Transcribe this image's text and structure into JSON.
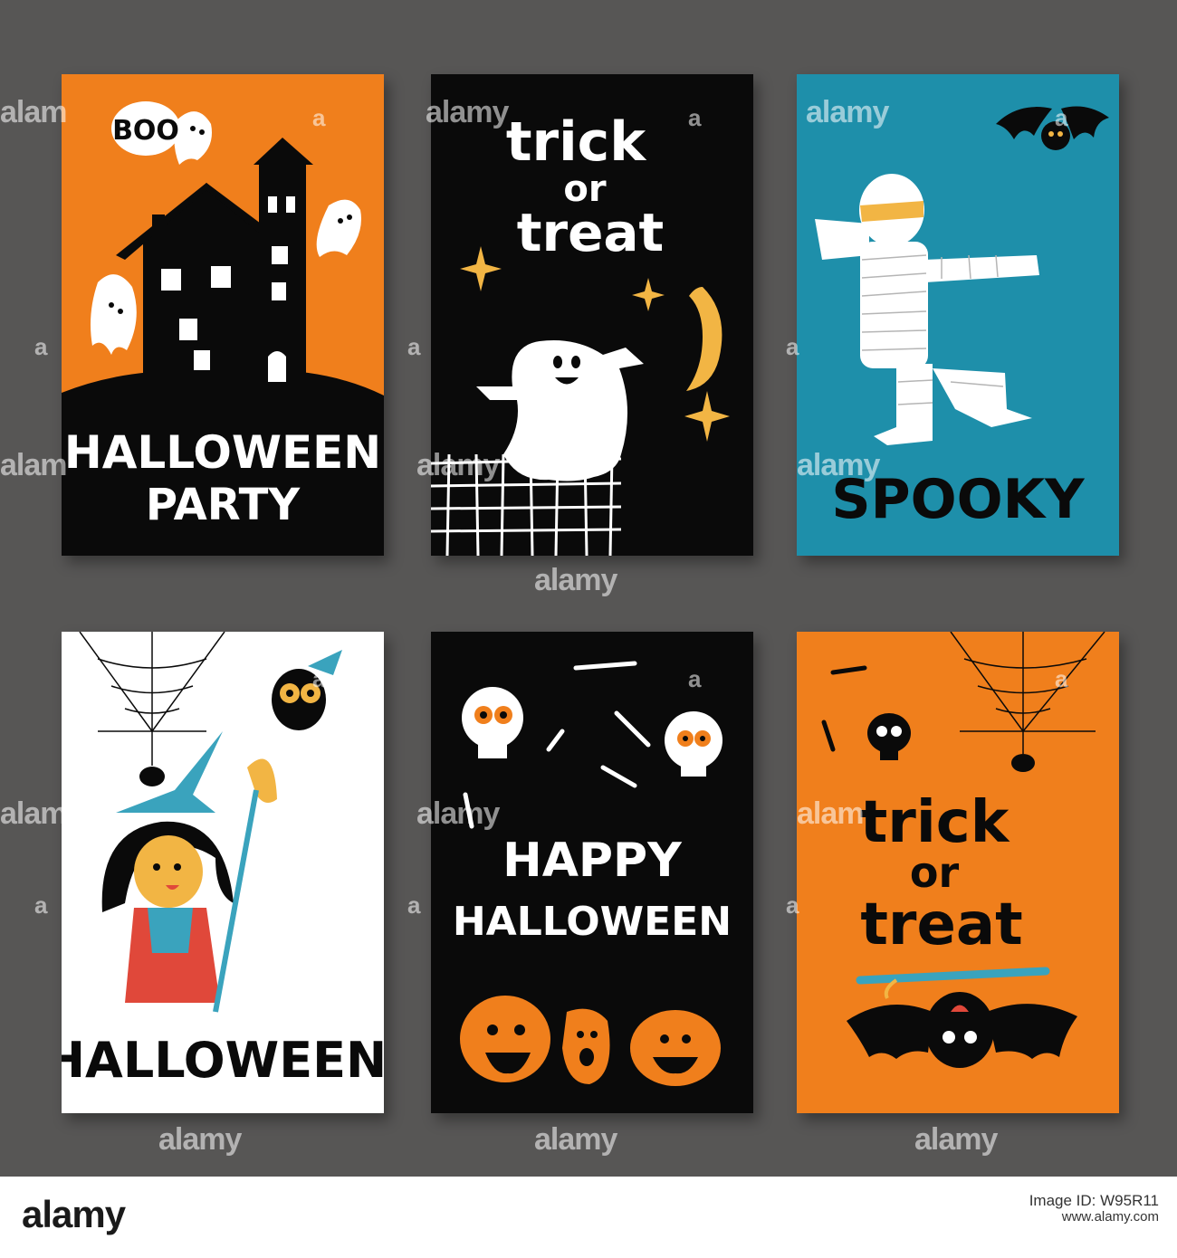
{
  "cards": {
    "party": {
      "text_line1": "HALLOWEEN",
      "text_line2": "PARTY",
      "bubble": "BOO",
      "bg": "#f07f1c"
    },
    "ghost": {
      "text_line1": "trick",
      "text_line2": "or",
      "text_line3": "treat",
      "bg": "#0a0a0a"
    },
    "mummy": {
      "text": "SPOOKY",
      "bg": "#1e8faa"
    },
    "witch": {
      "text": "HALLOWEEN",
      "bg": "#ffffff"
    },
    "skulls": {
      "text_line1": "HAPPY",
      "text_line2": "HALLOWEEN",
      "bg": "#0a0a0a"
    },
    "bat": {
      "text_line1": "trick",
      "text_line2": "or",
      "text_line3": "treat",
      "bg": "#f07f1c"
    }
  },
  "watermark": {
    "text": "alamy",
    "short": "alam",
    "mark": "a"
  },
  "footer": {
    "logo": "alamy",
    "image_id_label": "Image ID: W95R11",
    "site": "www.alamy.com"
  },
  "colors": {
    "background": "#575655",
    "orange": "#f07f1c",
    "black": "#0a0a0a",
    "teal": "#1e8faa",
    "white": "#ffffff"
  }
}
